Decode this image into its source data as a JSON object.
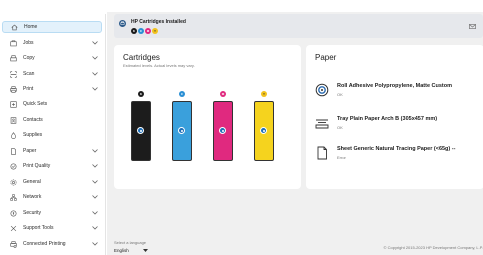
{
  "sidebar": {
    "items": [
      {
        "label": "Home",
        "icon": "home-icon"
      },
      {
        "label": "Jobs",
        "icon": "jobs-icon"
      },
      {
        "label": "Copy",
        "icon": "copy-icon"
      },
      {
        "label": "Scan",
        "icon": "scan-icon"
      },
      {
        "label": "Print",
        "icon": "print-icon"
      },
      {
        "label": "Quick Sets",
        "icon": "quick-sets-icon"
      },
      {
        "label": "Contacts",
        "icon": "contacts-icon"
      },
      {
        "label": "Supplies",
        "icon": "supplies-icon"
      },
      {
        "label": "Paper",
        "icon": "paper-icon"
      },
      {
        "label": "Print Quality",
        "icon": "print-quality-icon"
      },
      {
        "label": "General",
        "icon": "general-icon"
      },
      {
        "label": "Network",
        "icon": "network-icon"
      },
      {
        "label": "Security",
        "icon": "security-icon"
      },
      {
        "label": "Support Tools",
        "icon": "support-tools-icon"
      },
      {
        "label": "Connected Printing",
        "icon": "connected-printing-icon"
      }
    ]
  },
  "banner": {
    "title": "HP Cartridges Installed",
    "inks": [
      {
        "code": "K",
        "color": "#1a1a1a"
      },
      {
        "code": "C",
        "color": "#2a8fd4"
      },
      {
        "code": "M",
        "color": "#e2257f"
      },
      {
        "code": "Y",
        "color": "#f2c21b"
      }
    ]
  },
  "cartridges": {
    "title": "Cartridges",
    "subtitle": "Estimated levels. Actual levels may vary.",
    "items": [
      {
        "code": "K",
        "color": "#1c1c1c"
      },
      {
        "code": "C",
        "color": "#3aa0dc"
      },
      {
        "code": "M",
        "color": "#e0297f"
      },
      {
        "code": "Y",
        "color": "#f5d31e"
      }
    ]
  },
  "paper": {
    "title": "Paper",
    "items": [
      {
        "name": "Roll Adhesive Polypropylene, Matte Custom",
        "status": "OK",
        "icon": "roll-icon"
      },
      {
        "name": "Tray Plain Paper Arch B (305x457 mm)",
        "status": "OK",
        "icon": "tray-icon"
      },
      {
        "name": "Sheet Generic Natural Tracing Paper (<65g) --",
        "status": "Error",
        "icon": "sheet-icon"
      }
    ]
  },
  "footer": {
    "language_label": "Select a language",
    "language_value": "English",
    "copyright": "© Copyright 2015-2023 HP Development Company, L.P."
  }
}
